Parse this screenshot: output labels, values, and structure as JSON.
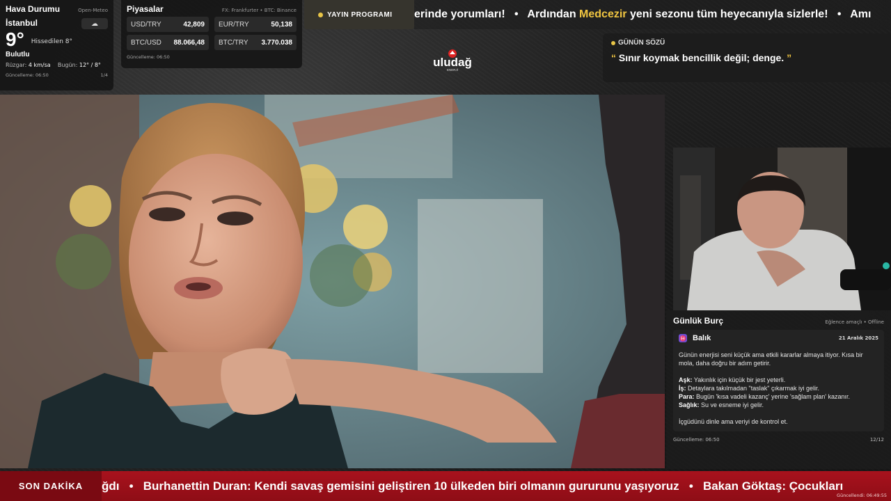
{
  "weather": {
    "title": "Hava Durumu",
    "source": "Open-Meteo",
    "city": "İstanbul",
    "temperature": "9°",
    "feels_like": "Hissedilen 8°",
    "condition": "Bulutlu",
    "wind_label": "Rüzgar:",
    "wind_value": "4 km/sa",
    "today_label": "Bugün:",
    "today_value": "12° / 8°",
    "updated": "Güncelleme: 06:50",
    "page": "1/4",
    "icon": "cloud-icon"
  },
  "markets": {
    "title": "Piyasalar",
    "source": "FX: Frankfurter • BTC: Binance",
    "items": [
      {
        "label": "USD/TRY",
        "value": "42,809"
      },
      {
        "label": "EUR/TRY",
        "value": "50,138"
      },
      {
        "label": "BTC/USD",
        "value": "88.066,48"
      },
      {
        "label": "BTC/TRY",
        "value": "3.770.038"
      }
    ],
    "updated": "Güncelleme: 06:50"
  },
  "program": {
    "label": "YAYIN PROGRAMI",
    "dot_color": "#e8c547"
  },
  "top_ticker": {
    "segments": [
      {
        "text": "erinde yorumları!   •   Ardından ",
        "highlight": false
      },
      {
        "text": "Medcezir",
        "highlight": true
      },
      {
        "text": " yeni sezonu tüm heyecanıyla sizlerle!   •   Amı",
        "highlight": false
      }
    ]
  },
  "logo": {
    "text": "uludağ",
    "subtext": "ENERJİ"
  },
  "quote": {
    "title": "GÜNÜN SÖZÜ",
    "open_mark": "“",
    "text": "Sınır koymak bencillik değil; denge.",
    "close_mark": "”"
  },
  "horoscope": {
    "title": "Günlük Burç",
    "mode": "Eğlence amaçlı • Offline",
    "sign": "Balık",
    "sign_icon": "pisces-icon",
    "date": "21 Aralık 2025",
    "summary": "Günün enerjisi seni küçük ama etkili kararlar almaya itiyor. Kısa bir mola, daha doğru bir adım getirir.",
    "lines": [
      {
        "label": "Aşk:",
        "text": " Yakınlık için küçük bir jest yeterli."
      },
      {
        "label": "İş:",
        "text": " Detaylara takılmadan \"taslak\" çıkarmak iyi gelir."
      },
      {
        "label": "Para:",
        "text": " Bugün 'kısa vadeli kazanç' yerine 'sağlam plan' kazanır."
      },
      {
        "label": "Sağlık:",
        "text": " Su ve esneme iyi gelir."
      }
    ],
    "closing": "İçgüdünü dinle ama veriyi de kontrol et.",
    "updated": "Güncelleme: 06:50",
    "page": "12/12"
  },
  "breaking": {
    "label": "SON DAKİKA",
    "text": "ğdı   •   Burhanettin Duran: Kendi savaş gemisini geliştiren 10 ülkeden biri olmanın gururunu yaşıyoruz   •   Bakan Göktaş: Çocukları",
    "updated": "Güncellendi: 06:49:55"
  },
  "colors": {
    "accent": "#f0c541",
    "breaking_red": "#a8121d",
    "panel_bg": "#1c1c1c"
  }
}
